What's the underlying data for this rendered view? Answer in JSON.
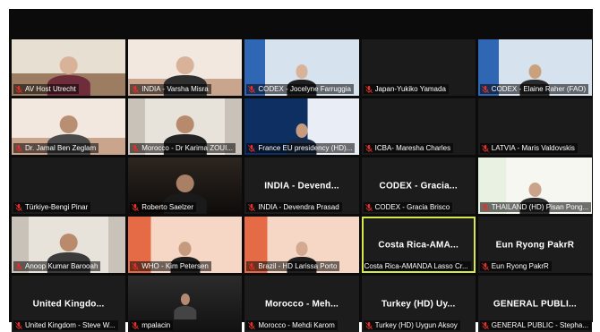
{
  "colors": {
    "mic_muted": "#e0312d",
    "selected_border": "#d7e84a",
    "window_bg": "#0b0b0b"
  },
  "icons": {
    "participant_audio": "microphone-muted-icon"
  },
  "tiles": [
    {
      "name": "AV Host Utrecht"
    },
    {
      "name": "INDIA - Varsha Misra"
    },
    {
      "name": "CODEX - Jocelyne Farruggia"
    },
    {
      "name": "Japan-Yukiko Yamada"
    },
    {
      "name": "CODEX - Elaine Raher (FAO)"
    },
    {
      "name": "Dr. Jamal Ben Zeglam"
    },
    {
      "name": "Morocco - Dr Karima ZOUI..."
    },
    {
      "name": "France EU presidency (HD)..."
    },
    {
      "name": "ICBA- Maresha Charles"
    },
    {
      "name": "LATVIA - Maris Valdovskis"
    },
    {
      "name": "Türkiye-Bengi Pinar"
    },
    {
      "name": "Roberto Saelzer"
    },
    {
      "name": "INDIA - Devendra Prasad",
      "display": "INDIA - Devend..."
    },
    {
      "name": "CODEX - Gracia Brisco",
      "display": "CODEX - Gracia..."
    },
    {
      "name": "THAILAND (HD) Pisan Pong..."
    },
    {
      "name": "Anoop Kumar Barooah"
    },
    {
      "name": "WHO - Kim Petersen"
    },
    {
      "name": "Brazil - HD Larissa Porto"
    },
    {
      "name": "Costa Rica-AMANDA Lasso Cr...",
      "display": "Costa Rica-AMA..."
    },
    {
      "name": "Eun Ryong PakrR",
      "display": "Eun Ryong PakrR"
    },
    {
      "name": "United Kingdom - Steve W...",
      "display": "United Kingdo..."
    },
    {
      "name": "mpalacin"
    },
    {
      "name": "Morocco - Mehdi Karom",
      "display": "Morocco - Meh..."
    },
    {
      "name": "Turkey (HD) Uygun Aksoy",
      "display": "Turkey (HD) Uy..."
    },
    {
      "name": "GENERAL PUBLIC - Stepha...",
      "display": "GENERAL PUBLI..."
    }
  ]
}
